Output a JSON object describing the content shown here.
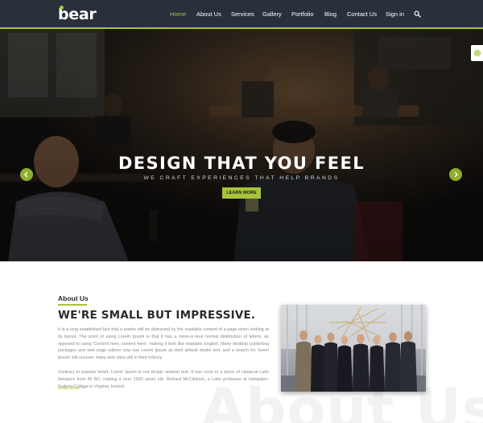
{
  "header": {
    "logo_text": "bear",
    "nav": [
      {
        "label": "Home",
        "active": true
      },
      {
        "label": "About Us",
        "active": false
      },
      {
        "label": "Services",
        "active": false
      },
      {
        "label": "Gallery",
        "active": false
      },
      {
        "label": "Portfolio",
        "active": false
      },
      {
        "label": "Blog",
        "active": false
      },
      {
        "label": "Contact Us",
        "active": false
      },
      {
        "label": "Sign in",
        "active": false
      }
    ],
    "search_icon": "search-icon"
  },
  "hero": {
    "title": "DESIGN THAT YOU FEEL",
    "subtitle": "WE CRAFT EXPERIENCES THAT HELP BRANDS",
    "button_label": "LEARN MORE",
    "slide_count": 3,
    "active_slide": 2,
    "prev_icon": "chevron-left-icon",
    "next_icon": "chevron-right-icon",
    "settings_icon": "gear-icon"
  },
  "about": {
    "label": "About Us",
    "heading": "WE'RE SMALL BUT IMPRESSIVE.",
    "paragraph1": "It is a long established fact that a reader will be distracted by the readable content of a page when looking at its layout. The point of using Lorem Ipsum is that it has a more-or-less normal distribution of letters, as opposed to using 'Content here, content here', making it look like readable English. Many desktop publishing packages and web page editors now use Lorem Ipsum as their default model text, and a search for 'lorem ipsum' will uncover many web sites still in their infancy.",
    "paragraph2": "Contrary to popular belief, Lorem Ipsum is not simply random text. It has roots in a piece of classical Latin literature from 45 BC, making it over 2000 years old. Richard McClintock, a Latin professor at Hampden-Sydney College in Virginia, looked.",
    "read_more": "Read More »",
    "watermark": "About Us"
  },
  "colors": {
    "accent": "#a8c43a",
    "header_bg": "#29303c",
    "heading_text": "#2b2b2b",
    "body_text": "#8a8a8a"
  }
}
